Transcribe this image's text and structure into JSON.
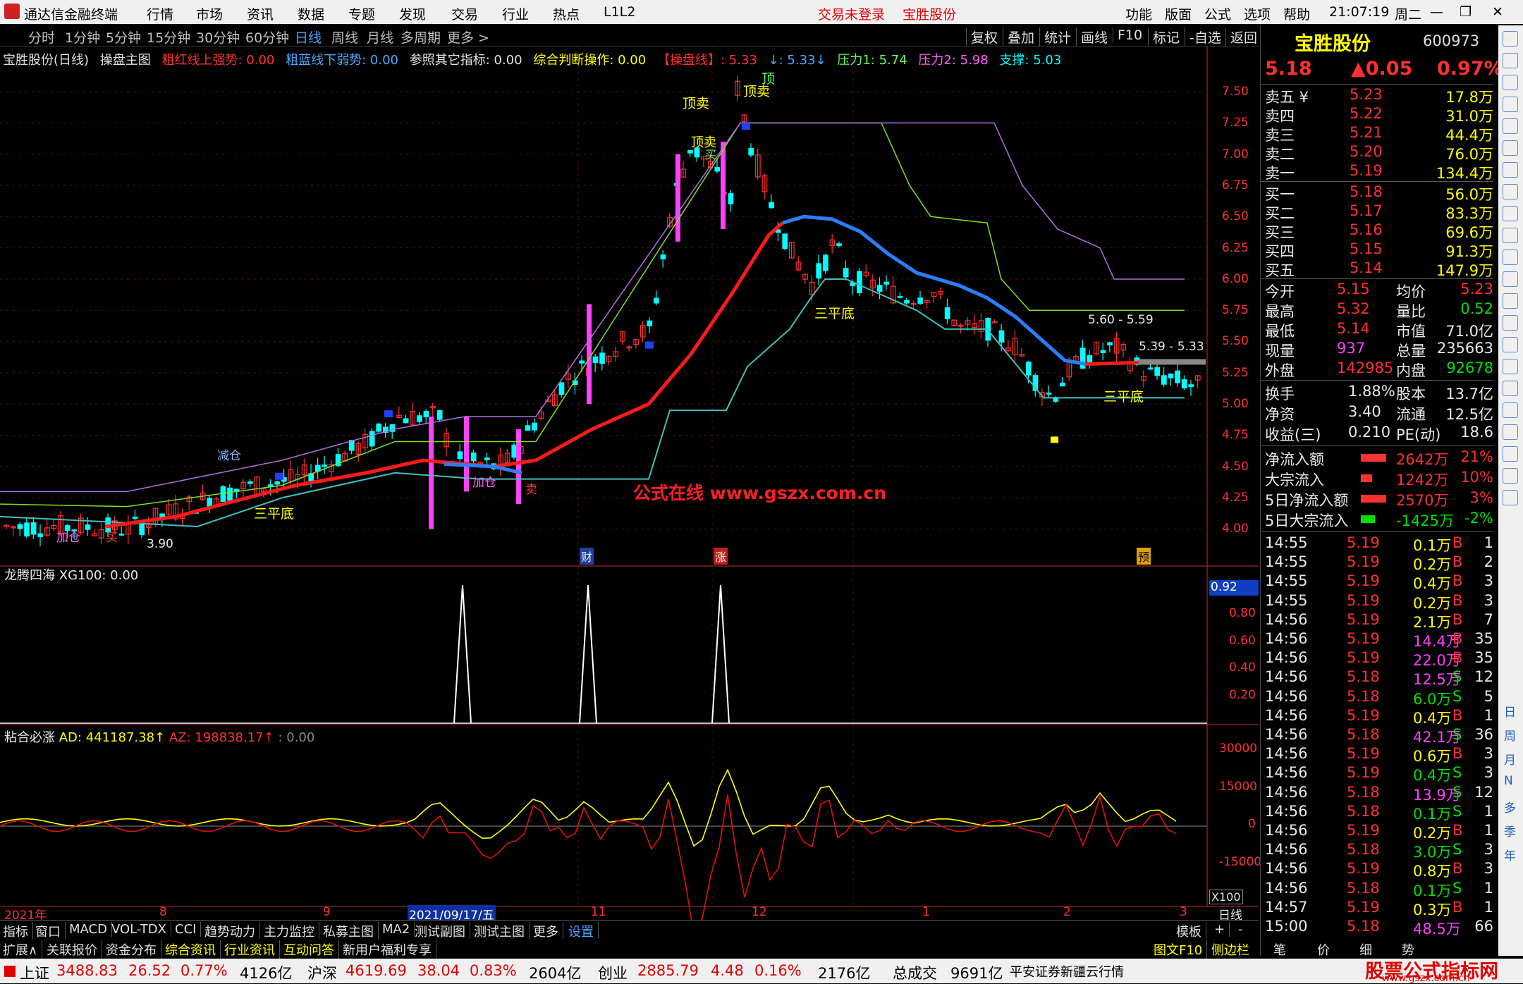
{
  "titlebar": {
    "app_title": "通达信金融终端",
    "menus": [
      "行情",
      "市场",
      "资讯",
      "数据",
      "专题",
      "发现",
      "交易",
      "行业",
      "热点",
      "L1L2"
    ],
    "login_status": "交易未登录",
    "stock_name": "宝胜股份",
    "right_menus": [
      "功能",
      "版面",
      "公式",
      "选项",
      "帮助"
    ],
    "time": "21:07:19",
    "weekday": "周二"
  },
  "periods": [
    "分时",
    "1分钟",
    "5分钟",
    "15分钟",
    "30分钟",
    "60分钟",
    "日线",
    "周线",
    "月线",
    "多周期",
    "更多 >"
  ],
  "active_period": "日线",
  "toolbar_buttons": [
    "复权",
    "叠加",
    "统计",
    "画线",
    "F10",
    "标记",
    "-自选",
    "返回"
  ],
  "indicator_line": [
    {
      "text": "宝胜股份(日线)",
      "color": "#e0e0e0"
    },
    {
      "text": "操盘主图",
      "color": "#e0e0e0"
    },
    {
      "text": "粗红线上强势: 0.00",
      "color": "#ff3030"
    },
    {
      "text": "粗蓝线下弱势: 0.00",
      "color": "#4aa8ff"
    },
    {
      "text": "参照其它指标: 0.00",
      "color": "#e0e0e0"
    },
    {
      "text": "综合判断操作: 0.00",
      "color": "#ffff00"
    },
    {
      "text": "【操盘线】: 5.33",
      "color": "#ff3030"
    },
    {
      "text": "↓: 5.33↓",
      "color": "#4aa8ff"
    },
    {
      "text": "压力1: 5.74",
      "color": "#60ff60"
    },
    {
      "text": "压力2: 5.98",
      "color": "#ff60ff"
    },
    {
      "text": "支撑: 5.03",
      "color": "#00ffff"
    }
  ],
  "main_axis_ticks": [
    "7.50",
    "7.25",
    "7.00",
    "6.75",
    "6.50",
    "6.25",
    "6.00",
    "5.75",
    "5.50",
    "5.25",
    "5.00",
    "4.75",
    "4.50",
    "4.25",
    "4.00"
  ],
  "annotations": {
    "top_sell_1": "顶卖",
    "top_sell_2": "顶卖",
    "top_sell_3": "顶卖",
    "top_label": "顶",
    "buy": "买",
    "three_flat_1": "三平底",
    "three_flat_2": "三平底",
    "three_flat_3": "三平底",
    "reduce": "减仓",
    "add_1": "加仓",
    "add_2": "加仓",
    "sell": "卖",
    "price_low": "3.90",
    "range_1": "5.60 - 5.59",
    "range_2": "5.39 - 5.33",
    "marker_cai": "财",
    "marker_zhang": "涨",
    "marker_yu": "预",
    "watermark": "公式在线 www.gszx.com.cn"
  },
  "sub1": {
    "title": "龙腾四海",
    "value": "XG100: 0.00",
    "ticks": [
      "0.80",
      "0.60",
      "0.40",
      "0.20"
    ],
    "current": "0.92"
  },
  "sub2": {
    "title": "粘合必涨",
    "ad": "AD: 441187.38↑",
    "az": "AZ: 198838.17↑",
    "extra": ": 0.00",
    "ticks": [
      "30000",
      "15000",
      "0",
      "-15000"
    ],
    "scale": "X100"
  },
  "date_axis": {
    "labels": [
      "2021年",
      "8",
      "9",
      "2021/09/17/五",
      "11",
      "12",
      "1",
      "2",
      "3"
    ],
    "period": "日线"
  },
  "bottom_tabs": [
    "指标",
    "窗口",
    "MACD",
    "VOL-TDX",
    "CCI",
    "趋势动力",
    "主力监控",
    "私募主图",
    "MA2",
    "测试副图",
    "测试主图",
    "更多",
    "设置"
  ],
  "bottom_right": [
    "模板",
    "+",
    "-"
  ],
  "ext_tabs": [
    "扩展∧",
    "关联报价",
    "资金分布",
    "综合资讯",
    "行业资讯",
    "互动问答",
    "新用户福利专享"
  ],
  "ext_right": [
    "图文F10",
    "侧边栏《",
    "笔",
    "价",
    "细",
    "势"
  ],
  "quote": {
    "name": "宝胜股份",
    "code": "600973",
    "price": "5.18",
    "change": "▲0.05",
    "pct": "0.97%",
    "asks": [
      {
        "label": "卖五 ¥",
        "price": "5.23",
        "vol": "17.8万"
      },
      {
        "label": "卖四",
        "price": "5.22",
        "vol": "31.0万"
      },
      {
        "label": "卖三",
        "price": "5.21",
        "vol": "44.4万"
      },
      {
        "label": "卖二",
        "price": "5.20",
        "vol": "76.0万"
      },
      {
        "label": "卖一",
        "price": "5.19",
        "vol": "134.4万"
      }
    ],
    "bids": [
      {
        "label": "买一",
        "price": "5.18",
        "vol": "56.0万"
      },
      {
        "label": "买二",
        "price": "5.17",
        "vol": "83.3万"
      },
      {
        "label": "买三",
        "price": "5.16",
        "vol": "69.6万"
      },
      {
        "label": "买四",
        "price": "5.15",
        "vol": "91.3万"
      },
      {
        "label": "买五",
        "price": "5.14",
        "vol": "147.9万"
      }
    ],
    "stats": [
      {
        "l1": "今开",
        "v1": "5.15",
        "c1": "up",
        "l2": "均价",
        "v2": "5.23",
        "c2": "up"
      },
      {
        "l1": "最高",
        "v1": "5.32",
        "c1": "up",
        "l2": "量比",
        "v2": "0.52",
        "c2": "down"
      },
      {
        "l1": "最低",
        "v1": "5.14",
        "c1": "up",
        "l2": "市值",
        "v2": "71.0亿",
        "c2": "white"
      },
      {
        "l1": "现量",
        "v1": "937",
        "c1": "mag",
        "l2": "总量",
        "v2": "235663",
        "c2": "white"
      },
      {
        "l1": "外盘",
        "v1": "142985",
        "c1": "up",
        "l2": "内盘",
        "v2": "92678",
        "c2": "down"
      }
    ],
    "stats2": [
      {
        "l1": "换手",
        "v1": "1.88%",
        "l2": "股本",
        "v2": "13.7亿"
      },
      {
        "l1": "净资",
        "v1": "3.40",
        "l2": "流通",
        "v2": "12.5亿"
      },
      {
        "l1": "收益(三)",
        "v1": "0.210",
        "l2": "PE(动)",
        "v2": "18.6"
      }
    ],
    "flows": [
      {
        "label": "净流入额",
        "val": "2642万",
        "pct": "21%",
        "color": "#ff3030",
        "bar": 0.9
      },
      {
        "label": "大宗流入",
        "val": "1242万",
        "pct": "10%",
        "color": "#ff3030",
        "bar": 0.4
      },
      {
        "label": "5日净流入额",
        "val": "2570万",
        "pct": "3%",
        "color": "#ff3030",
        "bar": 0.9
      },
      {
        "label": "5日大宗流入",
        "val": "-1425万",
        "pct": "-2%",
        "color": "#00e000",
        "bar": 0.5
      }
    ],
    "ticks": [
      [
        "14:55",
        "5.19",
        "0.1万",
        "B",
        "1"
      ],
      [
        "14:55",
        "5.19",
        "0.2万",
        "B",
        "2"
      ],
      [
        "14:55",
        "5.19",
        "0.4万",
        "B",
        "3"
      ],
      [
        "14:55",
        "5.19",
        "0.2万",
        "B",
        "3"
      ],
      [
        "14:56",
        "5.19",
        "2.1万",
        "B",
        "7"
      ],
      [
        "14:56",
        "5.19",
        "14.4万",
        "B",
        "35"
      ],
      [
        "14:56",
        "5.19",
        "22.0万",
        "B",
        "35"
      ],
      [
        "14:56",
        "5.18",
        "12.5万",
        "S",
        "12"
      ],
      [
        "14:56",
        "5.18",
        "6.0万",
        "S",
        "5"
      ],
      [
        "14:56",
        "5.19",
        "0.4万",
        "B",
        "1"
      ],
      [
        "14:56",
        "5.18",
        "42.1万",
        "S",
        "36"
      ],
      [
        "14:56",
        "5.19",
        "0.6万",
        "B",
        "3"
      ],
      [
        "14:56",
        "5.19",
        "0.4万",
        "S",
        "3"
      ],
      [
        "14:56",
        "5.18",
        "13.9万",
        "S",
        "12"
      ],
      [
        "14:56",
        "5.18",
        "0.1万",
        "S",
        "1"
      ],
      [
        "14:56",
        "5.19",
        "0.2万",
        "B",
        "1"
      ],
      [
        "14:56",
        "5.18",
        "3.0万",
        "S",
        "3"
      ],
      [
        "14:56",
        "5.19",
        "0.8万",
        "B",
        "3"
      ],
      [
        "14:56",
        "5.18",
        "0.1万",
        "S",
        "1"
      ],
      [
        "14:57",
        "5.19",
        "0.3万",
        "B",
        "1"
      ],
      [
        "15:00",
        "5.18",
        "48.5万",
        "",
        "66"
      ]
    ]
  },
  "side_chars": [
    "日",
    "周",
    "月",
    "N",
    "多",
    "季",
    "年"
  ],
  "status": {
    "sh_name": "上证",
    "sh_val": "3488.83",
    "sh_chg": "26.52",
    "sh_pct": "0.77%",
    "sh_amt": "4126亿",
    "sz_name": "沪深",
    "sz_val": "4619.69",
    "sz_chg": "38.04",
    "sz_pct": "0.83%",
    "sz_amt": "2604亿",
    "cy_name": "创业",
    "cy_val": "2885.79",
    "cy_chg": "4.48",
    "cy_pct": "0.16%",
    "cy_amt": "2176亿",
    "total_label": "总成交",
    "total_val": "9691亿",
    "broker": "平安证券新疆云行情",
    "watermark": "股票公式指标网",
    "watermark_url": "www.gszx.com.cn"
  },
  "colors": {
    "up": "#ff3030",
    "down": "#00ffff",
    "ma_red": "#ff1a1a",
    "ma_blue": "#2a7fff",
    "support": "#40c0c0",
    "pressure1": "#80e020",
    "pressure2": "#b070e0"
  }
}
